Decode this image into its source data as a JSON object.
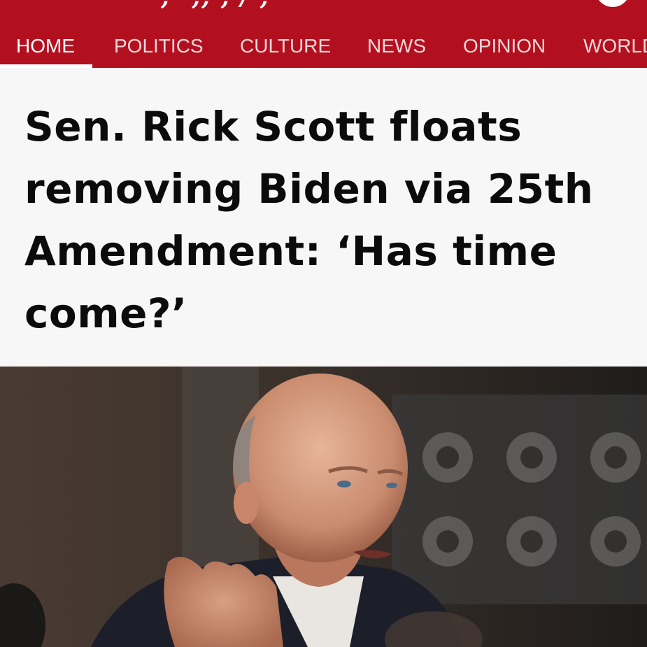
{
  "nav": {
    "items": [
      {
        "label": "HOME",
        "active": true
      },
      {
        "label": "POLITICS",
        "active": false
      },
      {
        "label": "CULTURE",
        "active": false
      },
      {
        "label": "NEWS",
        "active": false
      },
      {
        "label": "OPINION",
        "active": false
      },
      {
        "label": "WORLD",
        "active": false
      }
    ]
  },
  "article": {
    "headline": "Sen. Rick Scott floats removing Biden via 25th Amendment: ‘Has time come?’"
  },
  "colors": {
    "brand_red": "#b3101f",
    "background": "#f7f7f7",
    "headline_text": "#0b0b0b"
  },
  "icons": [
    "menu-icon",
    "profile-icon"
  ]
}
